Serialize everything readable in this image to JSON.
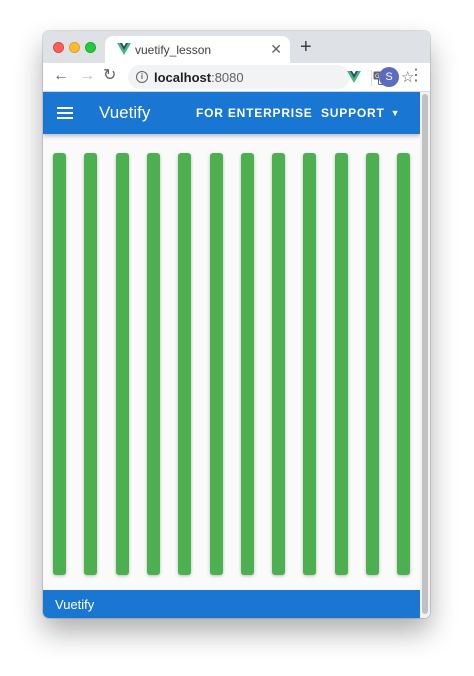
{
  "browser": {
    "tab": {
      "title": "vuetify_lesson",
      "close_glyph": "✕"
    },
    "new_tab_glyph": "+",
    "nav": {
      "back_glyph": "←",
      "forward_glyph": "→",
      "reload_glyph": "↻"
    },
    "address": {
      "host": "localhost",
      "port": ":8080",
      "info_glyph": "i"
    },
    "star_glyph": "☆",
    "profile_initial": "S",
    "menu_glyph": "⋮",
    "icons": [
      "vue-favicon-icon",
      "info-icon",
      "translate-icon",
      "star-icon",
      "vue-extension-icon",
      "kebab-menu-icon"
    ]
  },
  "app": {
    "title": "Vuetify",
    "nav": [
      {
        "label": "FOR ENTERPRISE"
      },
      {
        "label": "SUPPORT",
        "caret": "▼"
      }
    ],
    "stripe_count": 12,
    "footer": "Vuetify",
    "colors": {
      "primary": "#1976d2",
      "stripe": "#4caf50",
      "background": "#fafafa"
    }
  }
}
